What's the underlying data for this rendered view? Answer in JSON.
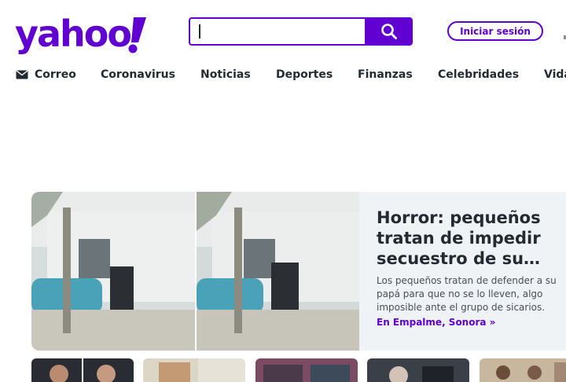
{
  "brand": {
    "name": "yahoo!",
    "color": "#6001d2"
  },
  "search": {
    "value": "",
    "placeholder": "",
    "button_icon": "search-icon"
  },
  "header": {
    "signin_label": "Iniciar sesión"
  },
  "nav": {
    "items": [
      {
        "label": "Correo",
        "icon": "mail-icon"
      },
      {
        "label": "Coronavirus"
      },
      {
        "label": "Noticias"
      },
      {
        "label": "Deportes"
      },
      {
        "label": "Finanzas"
      },
      {
        "label": "Celebridades"
      },
      {
        "label": "Vida"
      }
    ]
  },
  "hero": {
    "title": "Horror: pequeños tratan de impedir secuestro de su…",
    "summary": "Los pequeños tratan de defender a su papá para que no se lo lleven, algo imposible ante el grupo de sicarios.",
    "source": "En Empalme, Sonora »"
  },
  "colors": {
    "accent": "#6001d2",
    "text": "#232a31",
    "hero_bg": "#f0f3f5"
  }
}
